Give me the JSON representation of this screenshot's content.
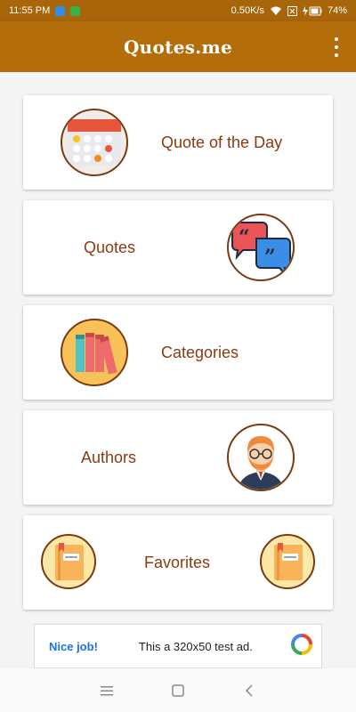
{
  "status_bar": {
    "time": "11:55 PM",
    "network_speed": "0.50K/s",
    "battery": "74%",
    "icons": [
      "app-notification-icon",
      "app-notification-icon",
      "wifi-icon",
      "sim-icon",
      "battery-charging-icon"
    ]
  },
  "app_bar": {
    "title": "Quotes.me",
    "menu_icon": "more-vert-icon"
  },
  "menu_cards": [
    {
      "label": "Quote of the Day",
      "icon": "calendar-icon"
    },
    {
      "label": "Quotes",
      "icon": "speech-bubbles-icon"
    },
    {
      "label": "Categories",
      "icon": "books-icon"
    },
    {
      "label": "Authors",
      "icon": "author-avatar-icon"
    },
    {
      "label": "Favorites",
      "icon": "notebook-icon"
    }
  ],
  "ad": {
    "badge": "Nice job!",
    "text": "This a 320x50 test ad.",
    "logo": "ad-logo-icon"
  },
  "nav_bar": {
    "buttons": [
      "menu-icon",
      "home-square-icon",
      "back-icon"
    ]
  },
  "colors": {
    "status_bar": "#a8650a",
    "app_bar": "#b46d0b",
    "card_text": "#8b3a12",
    "ad_link": "#1a73e8"
  }
}
